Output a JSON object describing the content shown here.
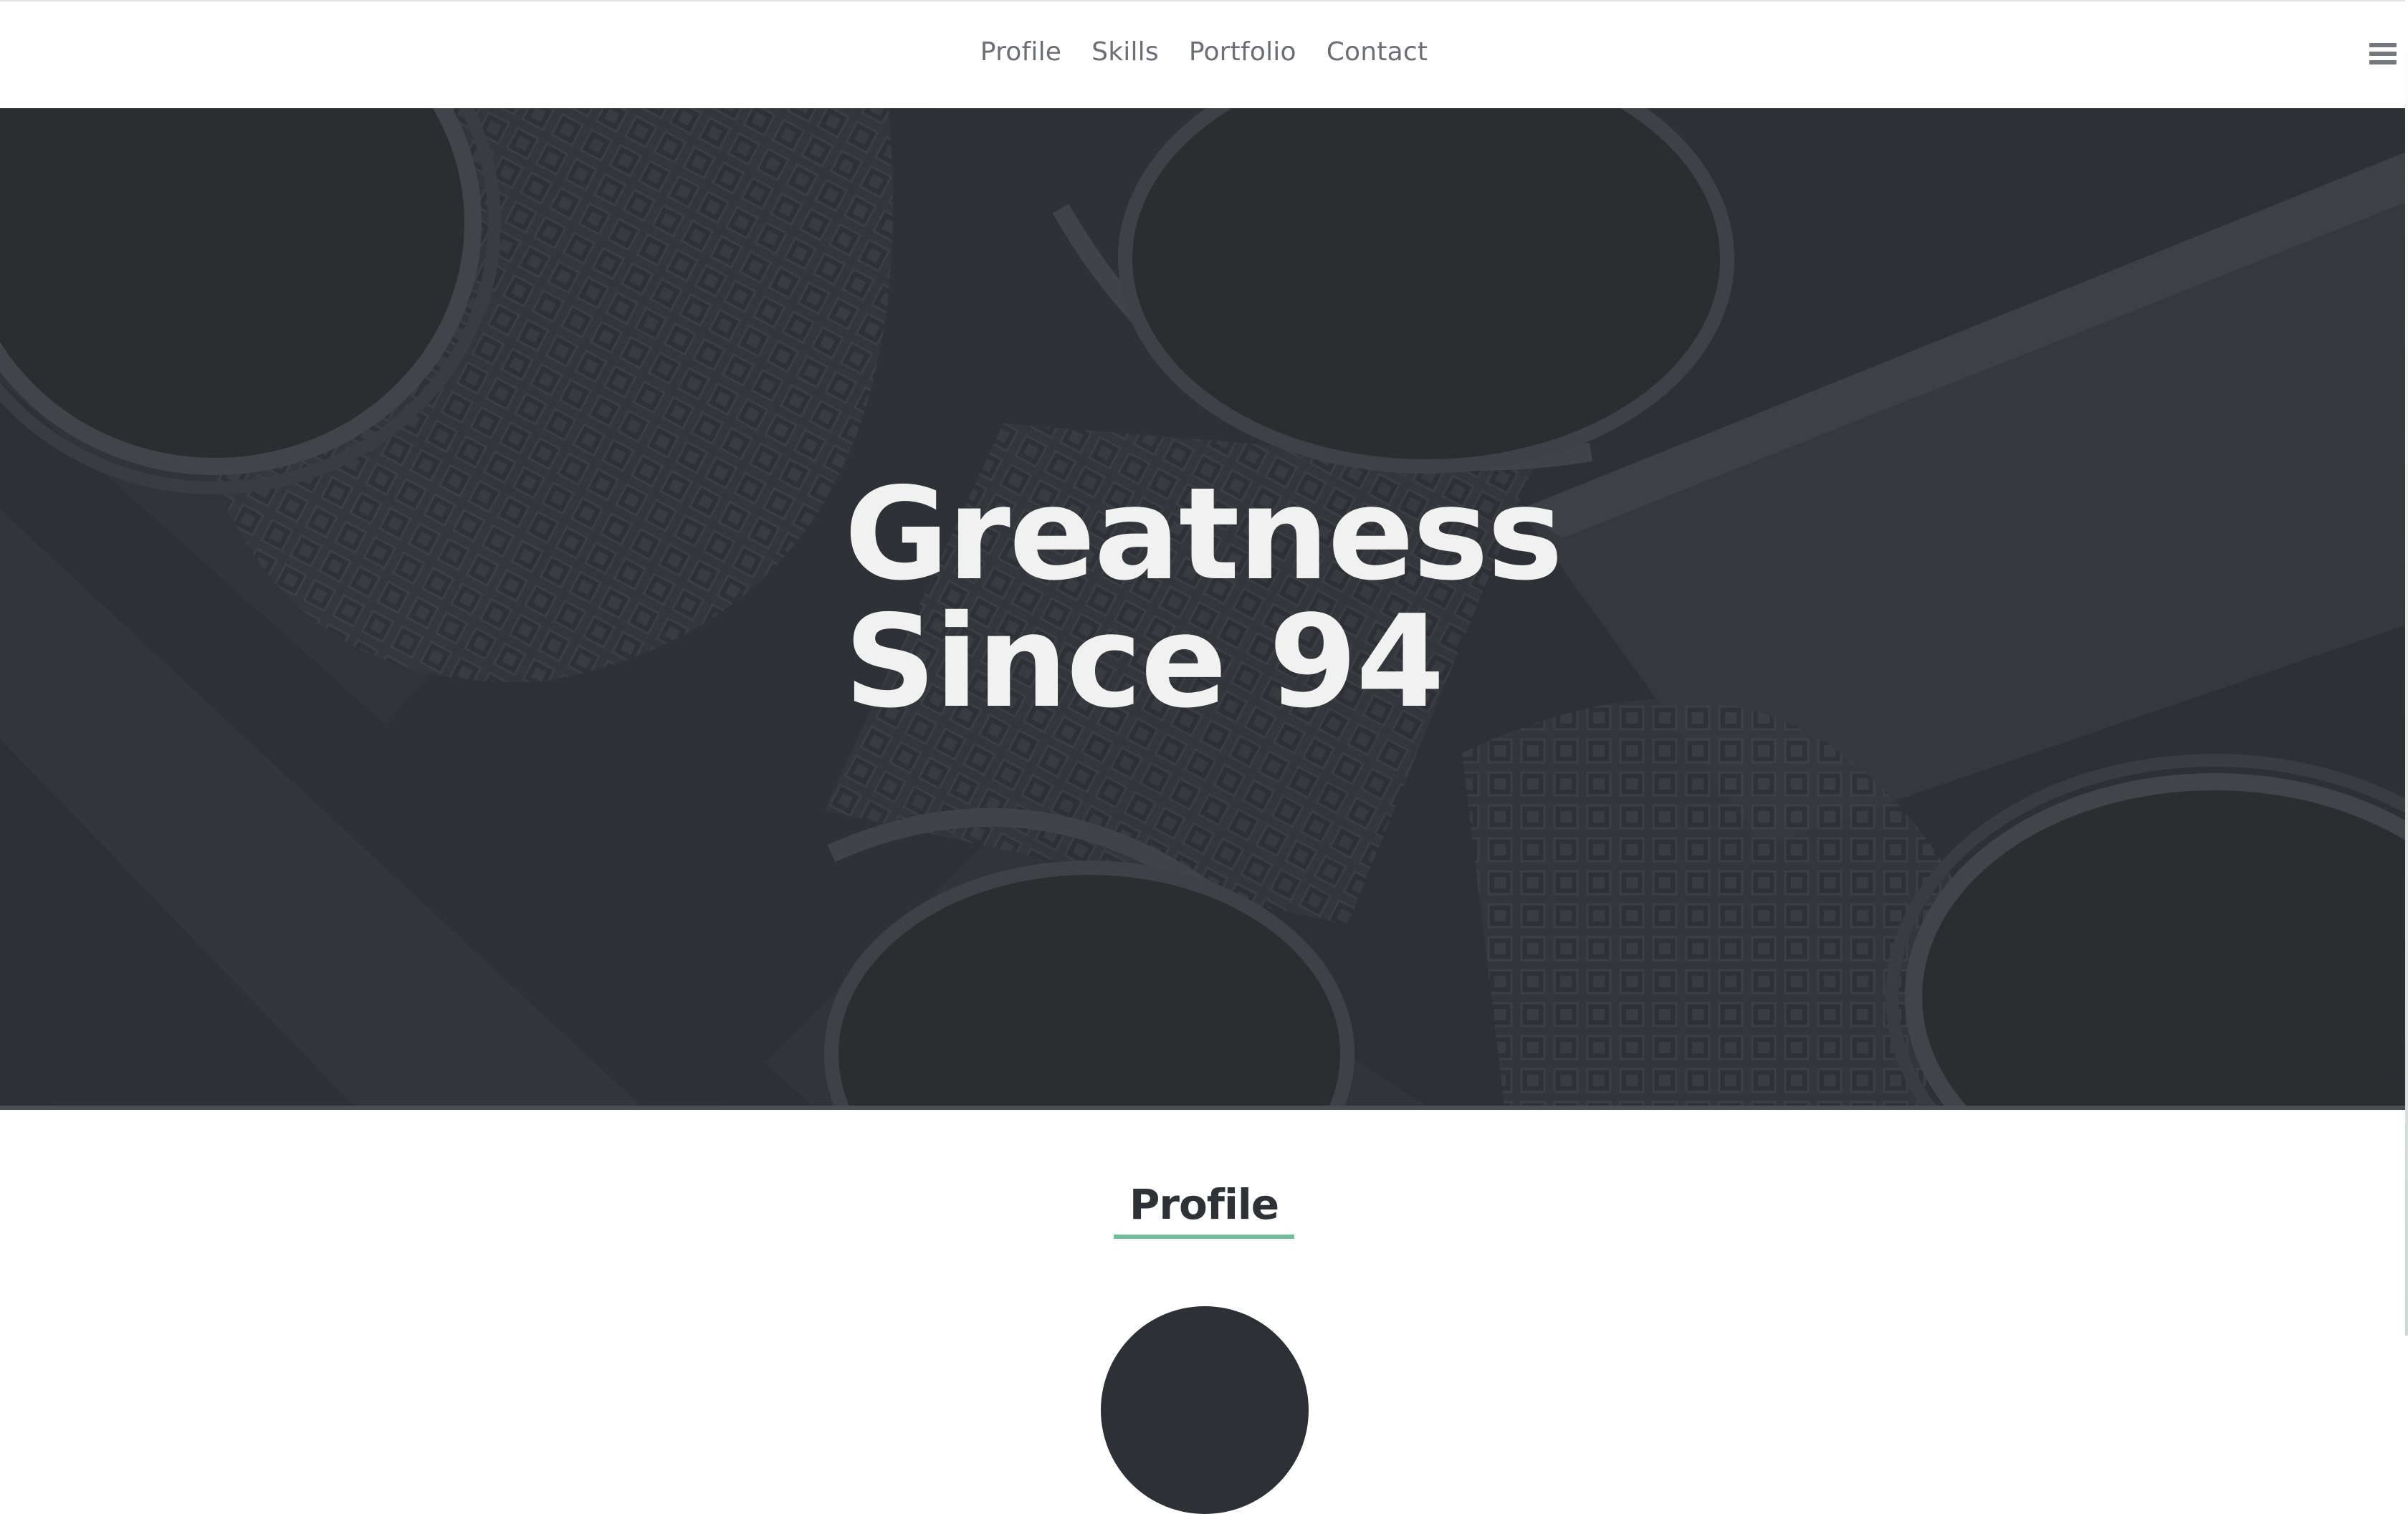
{
  "nav": {
    "links": [
      "Profile",
      "Skills",
      "Portfolio",
      "Contact"
    ],
    "menu_icon": "hamburger-menu-icon"
  },
  "hero": {
    "title_line1": "Greatness",
    "title_line2": "Since 94",
    "background": "architecture-arches-photo"
  },
  "profile": {
    "title": "Profile"
  },
  "colors": {
    "hero_bg": "#2d3035",
    "title_text": "#f1f1f1",
    "nav_text": "#6b6e72",
    "accent_underline": "#6fbf99",
    "heading_text": "#2e3237"
  }
}
